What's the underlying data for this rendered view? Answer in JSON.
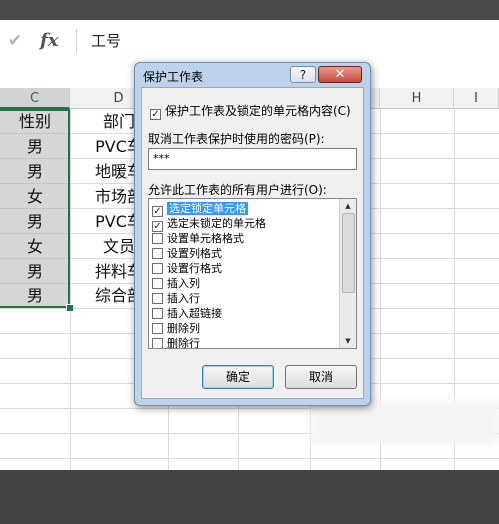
{
  "formula_bar": {
    "cancel_icon": "check-mark-icon",
    "fx_label": "fx",
    "cell_content": "工号"
  },
  "columns": [
    "C",
    "D",
    "H",
    "I"
  ],
  "rows": [
    {
      "gender": "性别",
      "dept": "部门"
    },
    {
      "gender": "男",
      "dept": "PVC车"
    },
    {
      "gender": "男",
      "dept": "地暖车"
    },
    {
      "gender": "女",
      "dept": "市场部"
    },
    {
      "gender": "男",
      "dept": "PVC车"
    },
    {
      "gender": "女",
      "dept": "文员"
    },
    {
      "gender": "男",
      "dept": "拌料车"
    },
    {
      "gender": "男",
      "dept": "综合部"
    }
  ],
  "dialog": {
    "title": "保护工作表",
    "help_label": "?",
    "close_label": "✕",
    "protect_check": {
      "checked": true,
      "label": "保护工作表及锁定的单元格内容(C)"
    },
    "password_label": "取消工作表保护时使用的密码(P):",
    "password_value": "***",
    "allow_label": "允许此工作表的所有用户进行(O):",
    "permissions": [
      {
        "label": "选定锁定单元格",
        "checked": true,
        "highlighted": true
      },
      {
        "label": "选定未锁定的单元格",
        "checked": true,
        "highlighted": false
      },
      {
        "label": "设置单元格格式",
        "checked": false,
        "highlighted": false
      },
      {
        "label": "设置列格式",
        "checked": false,
        "highlighted": false
      },
      {
        "label": "设置行格式",
        "checked": false,
        "highlighted": false
      },
      {
        "label": "插入列",
        "checked": false,
        "highlighted": false
      },
      {
        "label": "插入行",
        "checked": false,
        "highlighted": false
      },
      {
        "label": "插入超链接",
        "checked": false,
        "highlighted": false
      },
      {
        "label": "删除列",
        "checked": false,
        "highlighted": false
      },
      {
        "label": "删除行",
        "checked": false,
        "highlighted": false
      }
    ],
    "ok_label": "确定",
    "cancel_label": "取消"
  },
  "colors": {
    "selection": "#217346",
    "highlight": "#3399ff",
    "dialog_frame": "#bcd2ea"
  }
}
